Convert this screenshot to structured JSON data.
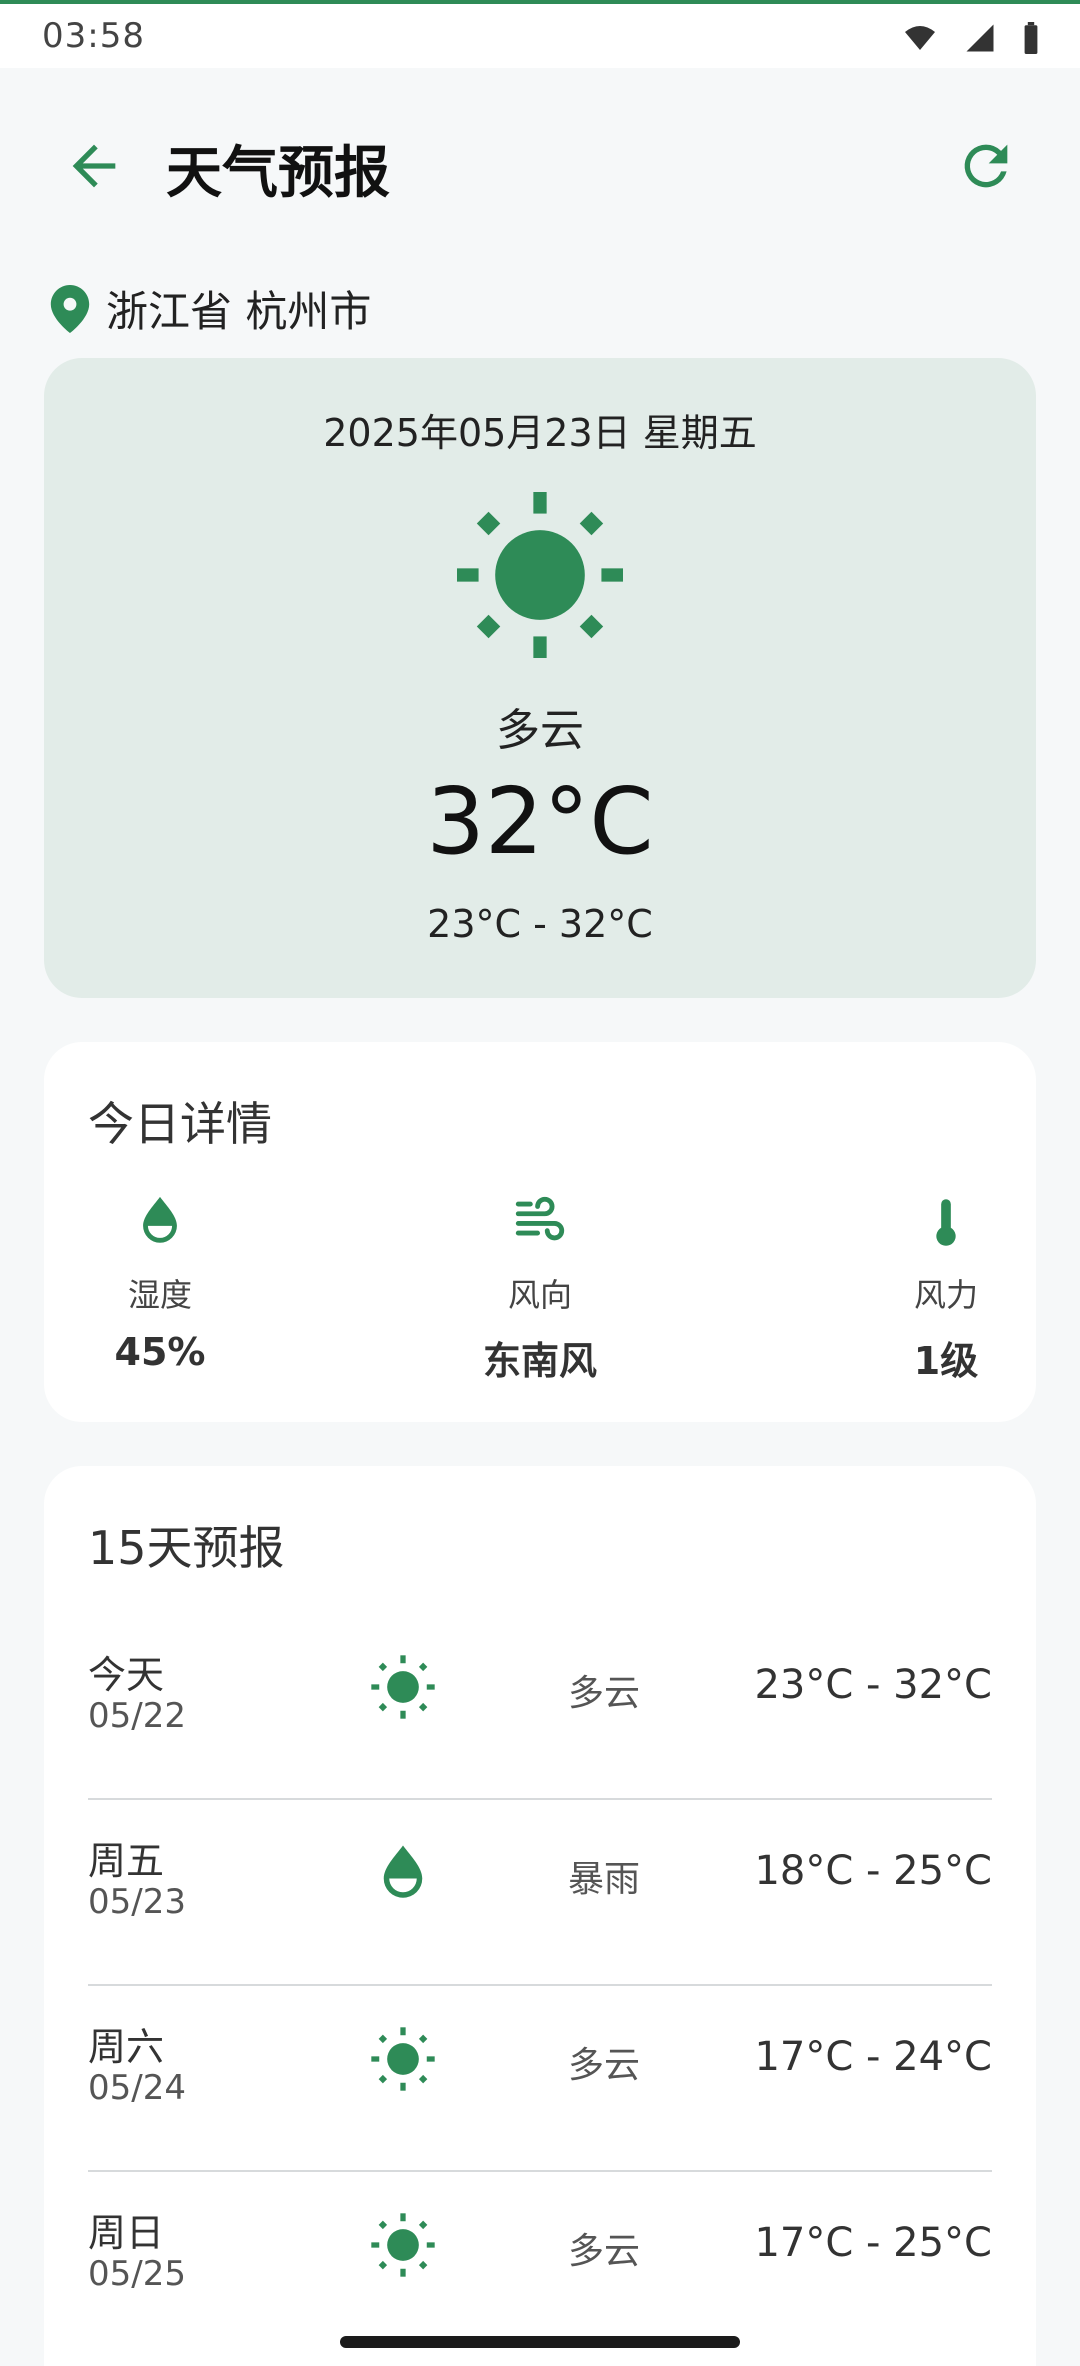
{
  "status_bar": {
    "time": "03:58",
    "icons": [
      "wifi-icon",
      "signal-icon",
      "battery-icon"
    ]
  },
  "app_bar": {
    "title": "天气预报",
    "back_icon": "arrow-left-icon",
    "refresh_icon": "refresh-icon"
  },
  "location": {
    "icon": "location-pin-icon",
    "text": "浙江省 杭州市"
  },
  "current": {
    "date": "2025年05月23日 星期五",
    "icon": "sun-icon",
    "condition": "多云",
    "temperature": "32°C",
    "range": "23°C - 32°C"
  },
  "details": {
    "title": "今日详情",
    "items": [
      {
        "icon": "water-drop-icon",
        "label": "湿度",
        "value": "45%"
      },
      {
        "icon": "wind-icon",
        "label": "风向",
        "value": "东南风"
      },
      {
        "icon": "thermometer-icon",
        "label": "风力",
        "value": "1级"
      }
    ]
  },
  "forecast": {
    "title": "15天预报",
    "rows": [
      {
        "day": "今天",
        "date": "05/22",
        "icon": "sun-icon",
        "condition": "多云",
        "range": "23°C - 32°C"
      },
      {
        "day": "周五",
        "date": "05/23",
        "icon": "water-drop-icon",
        "condition": "暴雨",
        "range": "18°C - 25°C"
      },
      {
        "day": "周六",
        "date": "05/24",
        "icon": "sun-icon",
        "condition": "多云",
        "range": "17°C - 24°C"
      },
      {
        "day": "周日",
        "date": "05/25",
        "icon": "sun-icon",
        "condition": "多云",
        "range": "17°C - 25°C"
      }
    ]
  },
  "colors": {
    "accent": "#2e8b57",
    "hero_bg": "#e2ece8",
    "page_bg": "#f6f8f9"
  }
}
